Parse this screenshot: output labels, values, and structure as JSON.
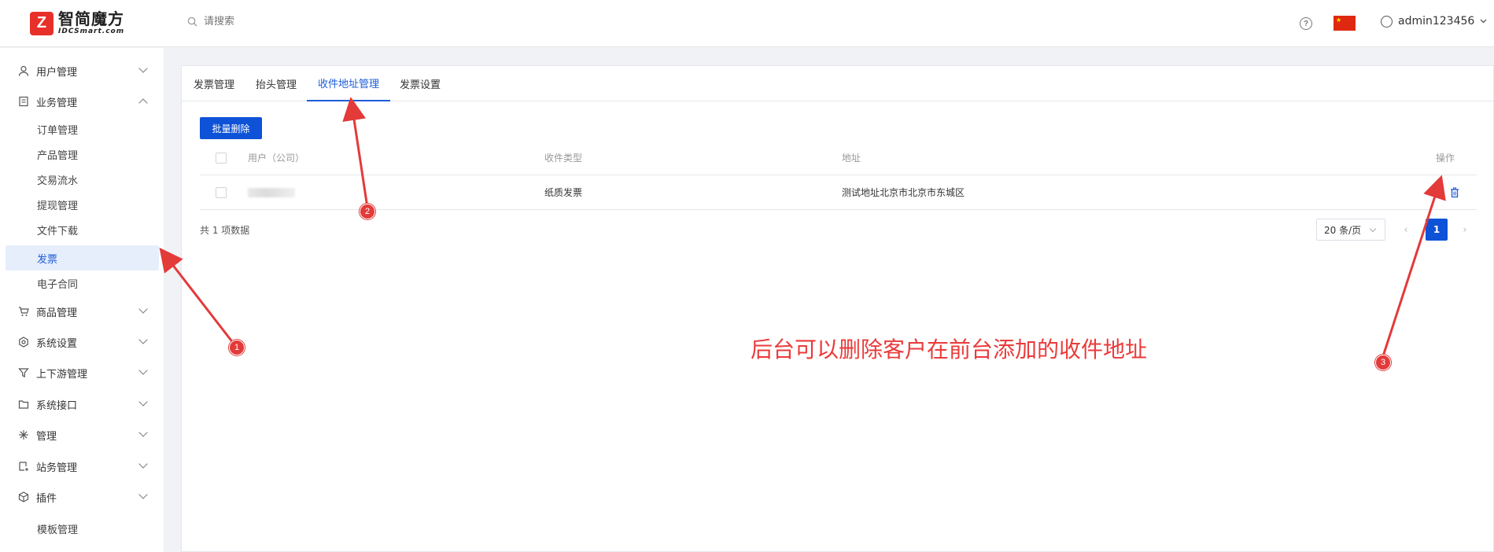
{
  "header": {
    "logo_cn": "智简魔方",
    "logo_en": "IDCSmart.com",
    "search_placeholder": "请搜索",
    "help_glyph": "?",
    "username": "admin123456"
  },
  "sidebar": {
    "items": [
      {
        "label": "用户管理",
        "icon": "user-icon",
        "expanded": false
      },
      {
        "label": "业务管理",
        "icon": "document-icon",
        "expanded": true
      },
      {
        "label": "商品管理",
        "icon": "cart-icon",
        "expanded": false
      },
      {
        "label": "系统设置",
        "icon": "gear-icon",
        "expanded": false
      },
      {
        "label": "上下游管理",
        "icon": "filter-icon",
        "expanded": false
      },
      {
        "label": "系统接口",
        "icon": "folder-icon",
        "expanded": false
      },
      {
        "label": "管理",
        "icon": "sparkle-icon",
        "expanded": false
      },
      {
        "label": "站务管理",
        "icon": "site-icon",
        "expanded": false
      },
      {
        "label": "插件",
        "icon": "cube-icon",
        "expanded": false
      }
    ],
    "sub_items": [
      "订单管理",
      "产品管理",
      "交易流水",
      "提现管理",
      "文件下载",
      "发票",
      "电子合同"
    ],
    "active_sub": "发票",
    "bottom_item": "模板管理"
  },
  "tabs": [
    {
      "label": "发票管理",
      "active": false
    },
    {
      "label": "抬头管理",
      "active": false
    },
    {
      "label": "收件地址管理",
      "active": true
    },
    {
      "label": "发票设置",
      "active": false
    }
  ],
  "toolbar": {
    "batch_delete": "批量删除"
  },
  "table": {
    "columns": [
      "用户（公司）",
      "收件类型",
      "地址",
      "操作"
    ],
    "rows": [
      {
        "user": "",
        "type": "纸质发票",
        "address": "测试地址北京市北京市东城区"
      }
    ]
  },
  "pagination": {
    "total_text": "共 1 项数据",
    "page_size": "20 条/页",
    "prev": "‹",
    "next": "›",
    "current": "1"
  },
  "annotation": {
    "text": "后台可以删除客户在前台添加的收件地址",
    "badges": [
      "1",
      "2",
      "3"
    ],
    "color": "#ea3b3b"
  },
  "colors": {
    "accent": "#0d52d7",
    "active_bg": "#e6eefc",
    "flag": "#de2910"
  }
}
